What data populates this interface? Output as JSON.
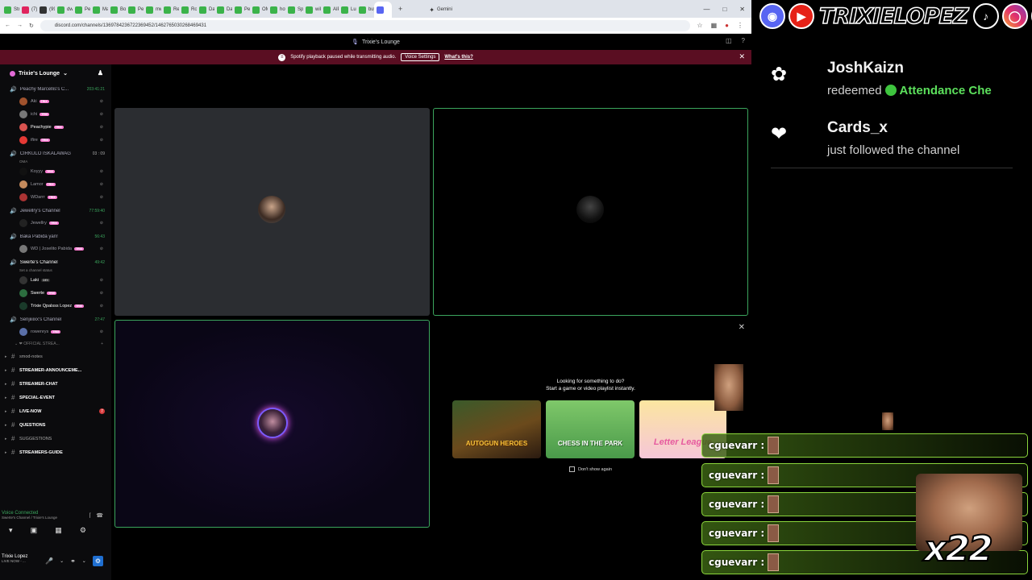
{
  "browser": {
    "tabs": [
      {
        "label": "Strea",
        "color": "#3bb34a"
      },
      {
        "label": "(7) Fa",
        "color": "#e0245e"
      },
      {
        "label": "(99+)",
        "color": "#333"
      },
      {
        "label": "dwlkli",
        "color": "#3bb34a"
      },
      {
        "label": "Pecha",
        "color": "#3bb34a"
      },
      {
        "label": "Marti",
        "color": "#3bb34a"
      },
      {
        "label": "Bolaki",
        "color": "#3bb34a"
      },
      {
        "label": "Peach",
        "color": "#3bb34a"
      },
      {
        "label": "mwnzy",
        "color": "#3bb34a"
      },
      {
        "label": "Redbli",
        "color": "#3bb34a"
      },
      {
        "label": "Roma",
        "color": "#3bb34a"
      },
      {
        "label": "Danyo",
        "color": "#3bb34a"
      },
      {
        "label": "Daren",
        "color": "#3bb34a"
      },
      {
        "label": "Pepeu",
        "color": "#3bb34a"
      },
      {
        "label": "OMZ",
        "color": "#3bb34a"
      },
      {
        "label": "hotsy",
        "color": "#3bb34a"
      },
      {
        "label": "Spicy",
        "color": "#3bb34a"
      },
      {
        "label": "wilde",
        "color": "#3bb34a"
      },
      {
        "label": "AIPLA",
        "color": "#3bb34a"
      },
      {
        "label": "LuPR",
        "color": "#3bb34a"
      },
      {
        "label": "buyey",
        "color": "#3bb34a"
      },
      {
        "label": "",
        "color": "#5865f2",
        "active": true
      }
    ],
    "gemini_tab": "Gemini",
    "url": "discord.com/channels/1369784236722369452/1462765030268469431"
  },
  "discord": {
    "window_title": "Trixie's Lounge",
    "notice_text": "Spotify playback paused while transmitting audio.",
    "notice_button": "Voice Settings",
    "notice_link": "What's this?",
    "server_name": "Trixie's Lounge",
    "voice_channels": [
      {
        "name": "Peachy Marcellis's C...",
        "timer": "203:41:21",
        "users": [
          {
            "name": "Aki",
            "tag": "TRIX",
            "color": "#a0522d"
          },
          {
            "name": "ichi",
            "tag": "TRIX",
            "color": "#777"
          },
          {
            "name": "Peachypie",
            "tag": "TRIX",
            "color": "#d9534f",
            "bright": true
          },
          {
            "name": "ifire",
            "tag": "TRIX",
            "color": "#e53935"
          }
        ]
      },
      {
        "name": "CIRKULO ISKALAWAG",
        "timer": "03 : 09",
        "sub": "OMA",
        "users": [
          {
            "name": "Koyyy",
            "tag": "TRIX",
            "color": "#111"
          },
          {
            "name": "Lamor",
            "tag": "TRIX",
            "color": "#c48a5c"
          },
          {
            "name": "WDarrr",
            "tag": "TRIX",
            "color": "#a33"
          }
        ]
      },
      {
        "name": "Jewellry's Channel",
        "timer": "77:59:40",
        "users": [
          {
            "name": "Jewellry",
            "tag": "TRIX",
            "color": "#222"
          }
        ]
      },
      {
        "name": "Baka Pabida yan!",
        "timer": "56:43",
        "users": [
          {
            "name": "WD | Joselito Pabida",
            "tag": "TRIX",
            "color": "#777"
          }
        ]
      },
      {
        "name": "Swerte's Channel",
        "timer": "49:42",
        "sub": "Set a channel status",
        "active": true,
        "users": [
          {
            "name": "Laki",
            "tag": "DEV",
            "color": "#333",
            "bright": true
          },
          {
            "name": "Swerte",
            "tag": "TRIX",
            "color": "#2c6e3f",
            "bright": true
          },
          {
            "name": "Trixie Qpalsss Lopez",
            "tag": "TRIX",
            "color": "#1a3a2a",
            "bright": true
          }
        ]
      },
      {
        "name": "Senjiiiixx's Channel",
        "timer": "27:47",
        "users": [
          {
            "name": "rowenrys",
            "tag": "TRIX",
            "color": "#5a6fa8"
          }
        ]
      }
    ],
    "category": "OFFICIAL STREA...",
    "text_channels": [
      {
        "label": "smod-notes"
      },
      {
        "label": "STREAMER-ANNOUNCEME...",
        "bold": true
      },
      {
        "label": "STREAMER-CHAT",
        "bold": true
      },
      {
        "label": "SPECIAL-EVENT",
        "bold": true
      },
      {
        "label": "LIVE-NOW",
        "bold": true,
        "badge": "7"
      },
      {
        "label": "QUESTIONS",
        "bold": true
      },
      {
        "label": "SUGGESTIONS"
      },
      {
        "label": "STREAMERS-GUIDE",
        "bold": true
      }
    ],
    "voice_status": "Voice Connected",
    "voice_location": "Swerte's Channel / Trixie's Lounge",
    "user_name": "Trixie Lopez",
    "user_status": "LIVE NOW - ..."
  },
  "activity": {
    "title_line1": "Looking for something to do?",
    "title_line2": "Start a game or video playlist instantly.",
    "games": [
      {
        "name": "Autogun Heroes",
        "label": "AUTOGUN HEROES"
      },
      {
        "name": "Chess in the Park",
        "label": "CHESS IN THE PARK"
      },
      {
        "name": "Letter League",
        "label": "Letter League"
      }
    ],
    "dont_show": "Don't show again"
  },
  "overlay": {
    "handle": "TRIXIELOPEZ",
    "alerts": [
      {
        "user": "JoshKaizn",
        "action": "redeemed",
        "reward": "Attendance Che"
      },
      {
        "user": "Cards_x",
        "action": "just followed the channel"
      }
    ],
    "chat_nick": "cguevarr :",
    "chat_count": 5,
    "multiplier": "x22"
  },
  "colors": {
    "accent_green": "#3ba55d",
    "notice_bg": "#5a0e22",
    "chat_border": "#8bd63c"
  }
}
